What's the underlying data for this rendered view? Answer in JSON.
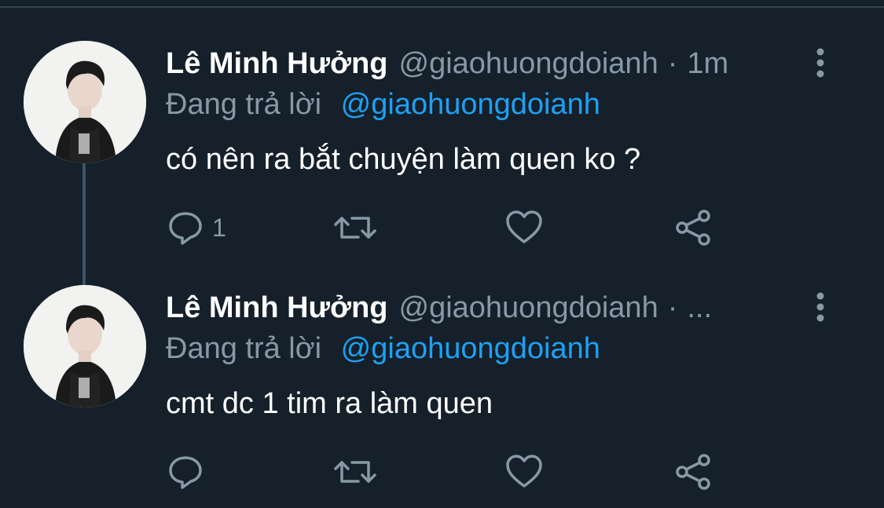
{
  "colors": {
    "background": "#15202b",
    "text_primary": "#ffffff",
    "text_secondary": "#8899a6",
    "accent": "#1da1f2",
    "divider": "#38444d",
    "thread_line": "#3d5466"
  },
  "tweets": [
    {
      "display_name": "Lê Minh Hưởng",
      "handle": "@giaohuongdoianh",
      "separator": "·",
      "time": "1m",
      "reply_prefix": "Đang trả lời",
      "reply_to": "@giaohuongdoianh",
      "text": "có nên ra bắt chuyện làm quen ko ?",
      "reply_count": "1",
      "icons": [
        "comment-icon",
        "retweet-icon",
        "heart-icon",
        "share-icon",
        "more-vertical-icon"
      ]
    },
    {
      "display_name": "Lê Minh Hưởng",
      "handle": "@giaohuongdoianh",
      "separator": "·",
      "time": "...",
      "reply_prefix": "Đang trả lời",
      "reply_to": "@giaohuongdoianh",
      "text": "cmt dc 1 tim ra làm quen",
      "reply_count": "",
      "icons": [
        "comment-icon",
        "retweet-icon",
        "heart-icon",
        "share-icon",
        "more-vertical-icon"
      ]
    }
  ]
}
